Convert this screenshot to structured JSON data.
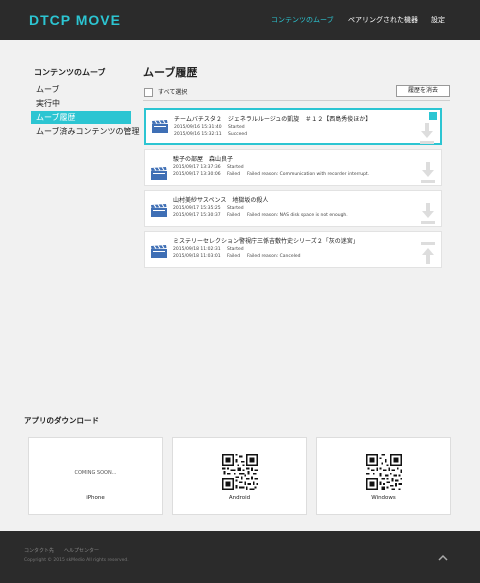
{
  "header": {
    "logo": "DTCP MOVE",
    "nav": [
      "コンテンツのムーブ",
      "ペアリングされた機器",
      "設定"
    ]
  },
  "sidebar": {
    "title": "コンテンツのムーブ",
    "items": [
      "ムーブ",
      "実行中",
      "ムーブ履歴",
      "ムーブ済みコンテンツの管理"
    ]
  },
  "main": {
    "title": "ムーブ履歴",
    "select_all": "すべて選択",
    "clear_button": "履歴を消去",
    "history": [
      {
        "title": "チームバチスタ２　ジェネラルルージュの凱旋　＃１２【西島秀俊ほか】",
        "rows": [
          {
            "date": "2015/09/16 15:31:40",
            "status": "Started",
            "reason": ""
          },
          {
            "date": "2015/09/16 15:32:11",
            "status": "Succeed",
            "reason": ""
          }
        ]
      },
      {
        "title": "駿子の部屋　森山良子",
        "rows": [
          {
            "date": "2015/09/17 13:37:36",
            "status": "Started",
            "reason": ""
          },
          {
            "date": "2015/09/17 13:30:06",
            "status": "Failed",
            "reason": "Failed reason: Communication with recorder interrupt."
          }
        ]
      },
      {
        "title": "山村美紗サスペンス　地獄坂の殺人",
        "rows": [
          {
            "date": "2015/09/17 15:35:25",
            "status": "Started",
            "reason": ""
          },
          {
            "date": "2015/09/17 15:30:37",
            "status": "Failed",
            "reason": "Failed reason: NAS disk space is not enough."
          }
        ]
      },
      {
        "title": "ミステリーセレクション警視庁三係吉敷竹史シリーズ２「灰の迷宮」",
        "rows": [
          {
            "date": "2015/09/18 11:02:31",
            "status": "Started",
            "reason": ""
          },
          {
            "date": "2015/09/18 11:03:01",
            "status": "Failed",
            "reason": "Failed reason: Canceled"
          }
        ]
      }
    ]
  },
  "apps": {
    "title": "アプリのダウンロード",
    "items": [
      {
        "name": "iPhone",
        "coming_soon": "COMING SOON..."
      },
      {
        "name": "Android"
      },
      {
        "name": "Windows"
      }
    ]
  },
  "footer": {
    "links": [
      "コンタクト先",
      "ヘルプセンター"
    ],
    "copyright": "Copyright © 2015 skMedio All rights reserved."
  },
  "colors": {
    "accent": "#2cc5d2",
    "dark": "#2b2b2b",
    "clapper": "#3f6fb5"
  }
}
